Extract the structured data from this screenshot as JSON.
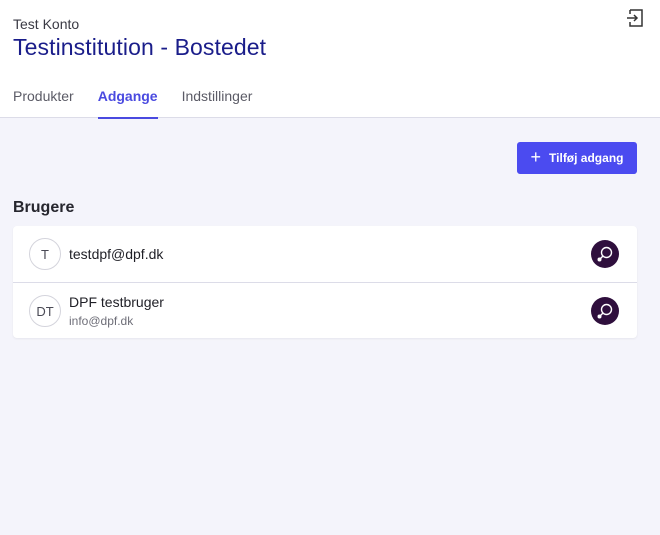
{
  "header": {
    "account_label": "Test Konto",
    "title": "Testinstitution - Bostedet",
    "logout_icon": "logout-icon"
  },
  "tabs": [
    {
      "label": "Produkter",
      "active": false
    },
    {
      "label": "Adgange",
      "active": true
    },
    {
      "label": "Indstillinger",
      "active": false
    }
  ],
  "actions": {
    "add_access_label": "Tilføj adgang",
    "add_icon": "plus-icon"
  },
  "users_section": {
    "title": "Brugere",
    "users": [
      {
        "initials": "T",
        "name": "testdpf@dpf.dk",
        "email": ""
      },
      {
        "initials": "DT",
        "name": "DPF testbruger",
        "email": "info@dpf.dk"
      }
    ]
  },
  "colors": {
    "accent": "#4b4bf0",
    "title": "#1a1d8a",
    "action_button": "#2f0f3d",
    "background": "#f4f4fb"
  }
}
